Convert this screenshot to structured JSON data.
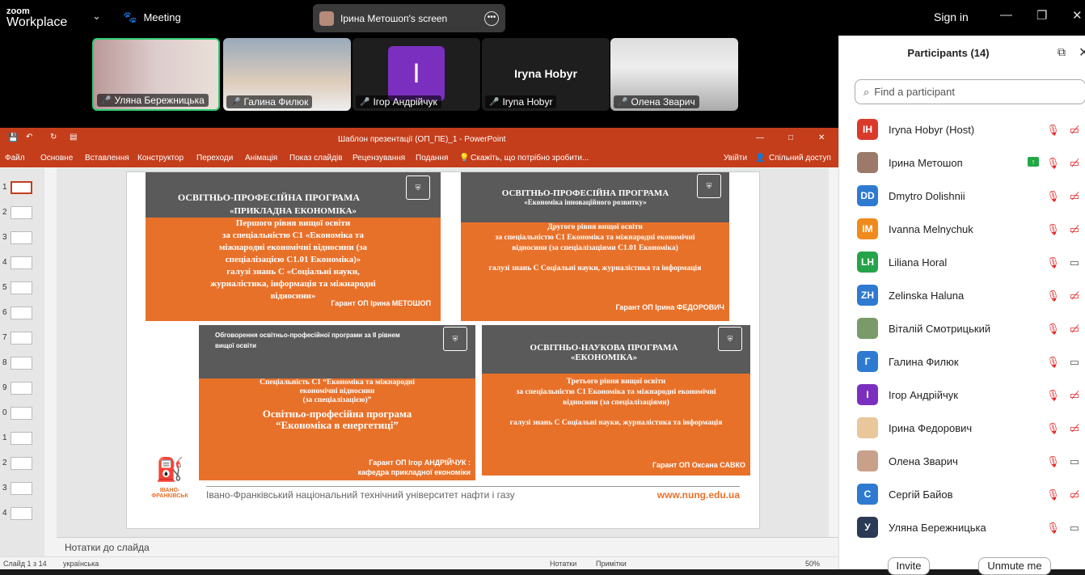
{
  "top": {
    "brand1": "zoom",
    "brand2": "Workplace",
    "meeting": "Meeting",
    "share": "Ірина Метошоп's screen",
    "signin": "Sign in"
  },
  "tiles": [
    {
      "name": "Уляна Бережницька"
    },
    {
      "name": "Галина Филюк"
    },
    {
      "name": "Ігор Андрійчук",
      "initial": "I"
    },
    {
      "name": "Iryna Hobyr",
      "big": "Iryna Hobyr"
    },
    {
      "name": "Олена Зварич"
    }
  ],
  "ppt": {
    "title": "Шаблон презентації (ОП_ПЕ)_1 - PowerPoint",
    "ribbon": [
      "Файл",
      "Основне",
      "Вставлення",
      "Конструктор",
      "Переходи",
      "Анімація",
      "Показ слайдів",
      "Рецензування",
      "Подання",
      "Скажіть, що потрібно зробити..."
    ],
    "signin": "Увійти",
    "share": "Спільний доступ",
    "thumbs": [
      "1",
      "2",
      "3",
      "4",
      "5",
      "6",
      "7",
      "8",
      "9",
      "0",
      "1",
      "2",
      "3",
      "4"
    ],
    "notes": "Нотатки до слайда",
    "status_slide": "Слайд 1 з 14",
    "status_lang": "українська",
    "status_notes": "Нотатки",
    "status_comments": "Примітки",
    "zoom": "50%"
  },
  "slide": {
    "c1": {
      "h1": "ОСВІТНЬО-ПРОФЕСІЙНА ПРОГРАМА",
      "h2": "«ПРИКЛАДНА ЕКОНОМІКА»",
      "l1": "Першого рівня вищої освіти",
      "l2": "за спеціальністю C1 «Економіка та",
      "l3": "міжнародні економічні відносини (за",
      "l4": "спеціалізацією C1.01 Економіка)»",
      "l5": "галузі знань С «Соціальні науки,",
      "l6": "журналістика, інформація та міжнародні",
      "l7": "відносини»",
      "g": "Гарант ОП Ірина МЕТОШОП"
    },
    "c2": {
      "h1": "ОСВІТНЬО-ПРОФЕСІЙНА ПРОГРАМА",
      "h2": "«Економіка інноваційного розвитку»",
      "l1": "Другого рівня вищої освіти",
      "l2": "за спеціальністю C1  Економіка та міжнародні економічні",
      "l3": "відносини (за спеціалізаціями C1.01 Економіка)",
      "l4": "галузі знань С Соціальні науки, журналістика та інформація",
      "g": "Гарант ОП Ірина ФЕДОРОВИЧ"
    },
    "c3": {
      "h1": "Обговорення освітньо-професійної програми за ІІ рівнем",
      "h2": "вищої освіти",
      "l1": "Спеціальність С1 “Економіка та міжнародні",
      "l2": "економічні відносини",
      "l3": "(за спеціалізацією)”",
      "l4": "Освітньо-професійна програма",
      "l5": "“Економіка в енергетиці”",
      "g1": "Гарант ОП Ігор АНДРІЙЧУК :",
      "g2": "кафедра прикладної економіки"
    },
    "c4": {
      "h1": "ОСВІТНЬО-НАУКОВА ПРОГРАМА",
      "h2": "«ЕКОНОМІКА»",
      "l1": "Третього рівня вищої освіти",
      "l2": "за спеціальністю C1  Економіка та міжнародні економічні",
      "l3": "відносини (за спеціалізаціями)",
      "l4": "галузі знань С Соціальні науки, журналістика та інформація",
      "g": "Гарант ОП Оксана САВКО"
    },
    "uni": "ІВАНО-ФРАНКІВСЬК",
    "footer": "Івано-Франківський національний технічний університет нафти і газу",
    "url": "www.nung.edu.ua"
  },
  "panel": {
    "title": "Participants (14)",
    "search_ph": "Find a participant",
    "people": [
      {
        "i": "IH",
        "n": "Iryna Hobyr (Host)",
        "c": "#d93a2b",
        "video": "off"
      },
      {
        "i": "",
        "n": "Ірина Метошоп",
        "c": "#9c7a6a",
        "video": "off",
        "share": true
      },
      {
        "i": "DD",
        "n": "Dmytro Dolishnii",
        "c": "#2f7ad1",
        "video": "off"
      },
      {
        "i": "IM",
        "n": "Ivanna Melnychuk",
        "c": "#f08a1c",
        "video": "off"
      },
      {
        "i": "LH",
        "n": "Liliana Horal",
        "c": "#26a34a",
        "video": "on"
      },
      {
        "i": "ZH",
        "n": "Zelinska Haluna",
        "c": "#2f7ad1",
        "video": "off"
      },
      {
        "i": "",
        "n": "Віталій Смотрицький",
        "c": "#7a9a6a",
        "video": "off"
      },
      {
        "i": "Г",
        "n": "Галина Филюк",
        "c": "#2f7ad1",
        "video": "on"
      },
      {
        "i": "І",
        "n": "Ігор Андрійчук",
        "c": "#7b2fbf",
        "video": "off"
      },
      {
        "i": "",
        "n": "Ірина Федорович",
        "c": "#e8c79a",
        "video": "off"
      },
      {
        "i": "",
        "n": "Олена Зварич",
        "c": "#c9a08a",
        "video": "on"
      },
      {
        "i": "С",
        "n": "Сергій Байов",
        "c": "#2f7ad1",
        "video": "off"
      },
      {
        "i": "У",
        "n": "Уляна Бережницька",
        "c": "#2b3a55",
        "video": "on"
      }
    ],
    "invite": "Invite",
    "unmute": "Unmute me"
  }
}
